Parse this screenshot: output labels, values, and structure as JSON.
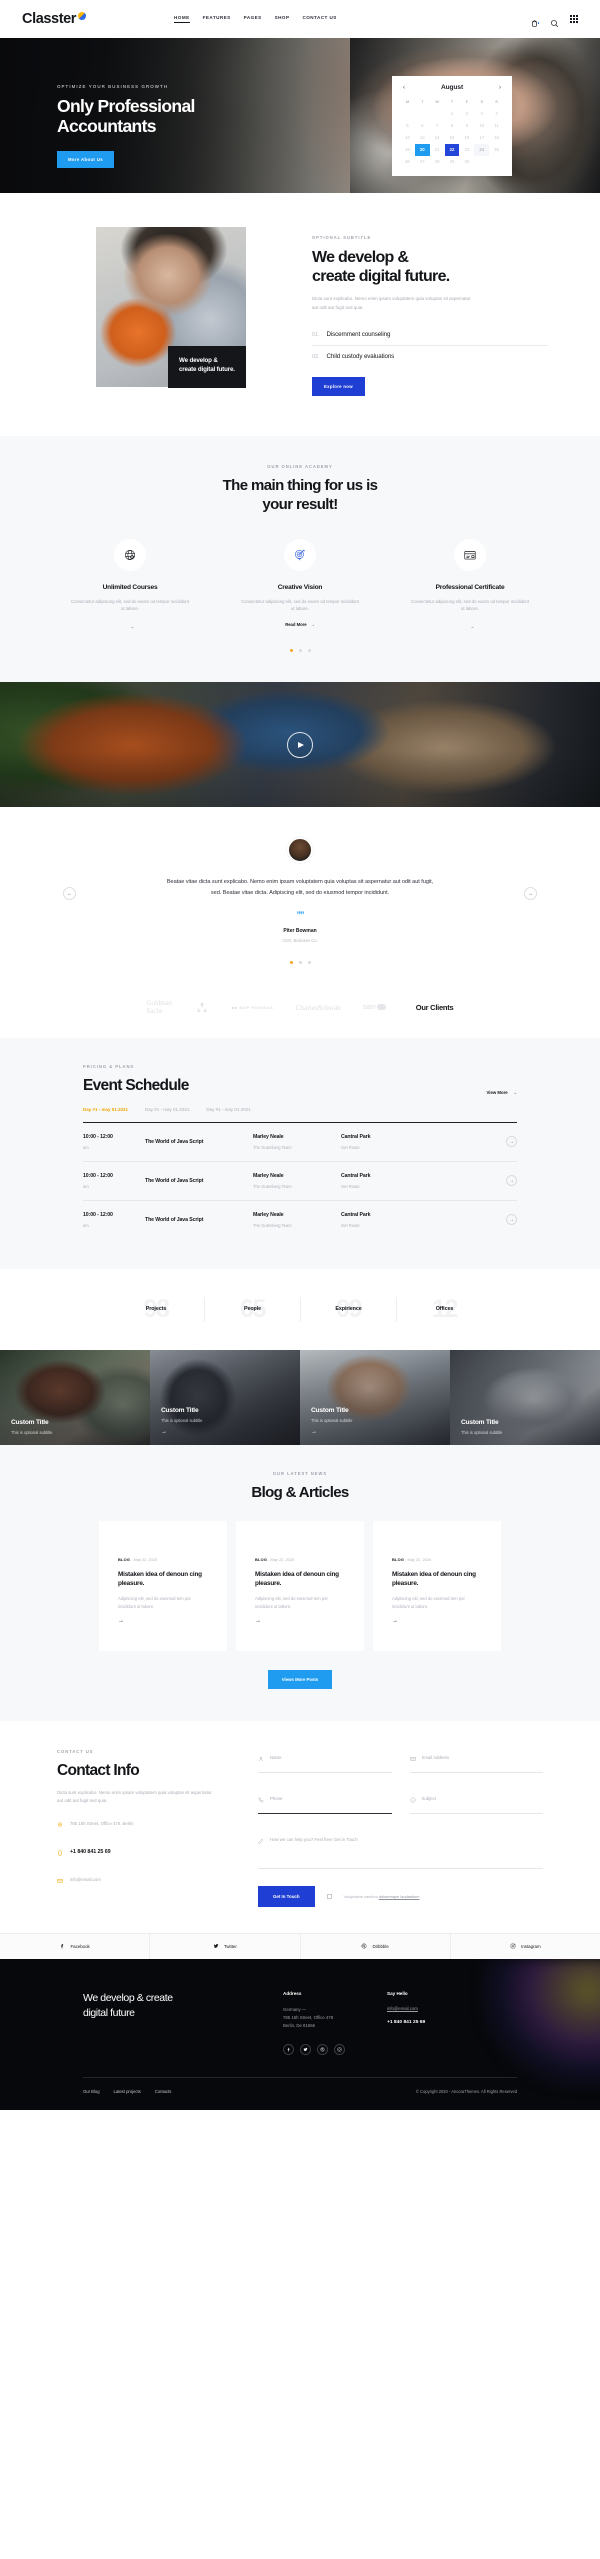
{
  "header": {
    "brand": "Classter",
    "nav": [
      {
        "label": "HOME",
        "active": true
      },
      {
        "label": "FEATURES",
        "active": false
      },
      {
        "label": "PAGES",
        "active": false
      },
      {
        "label": "SHOP",
        "active": false
      },
      {
        "label": "CONTACT US",
        "active": false
      }
    ],
    "tools": [
      "cart-icon",
      "search-icon",
      "grid-menu-icon"
    ]
  },
  "hero": {
    "kicker": "OPTIMIZE YOUR BUSINESS GROWTH",
    "title_line1": "Only Professional",
    "title_line2": "Accountants",
    "cta": "More About Us",
    "calendar": {
      "month": "August",
      "prev": "‹",
      "next": "›",
      "dow": [
        "M",
        "T",
        "W",
        "T",
        "F",
        "S",
        "S"
      ],
      "blanks": 3,
      "days": [
        1,
        2,
        3,
        4,
        5,
        6,
        7,
        8,
        9,
        10,
        11,
        12,
        13,
        14,
        15,
        16,
        17,
        18,
        19,
        20,
        21,
        22,
        23,
        24,
        25,
        26,
        27,
        28,
        29,
        30
      ],
      "highlight_light_blue": 20,
      "highlight_dark_blue": 22,
      "highlight_grey": 24
    }
  },
  "about": {
    "card_text": "We develop & create digital future.",
    "kicker": "OPTIONAL SUBTITLE",
    "title_line1": "We develop &",
    "title_line2": "create digital future.",
    "body": "Dicta sunt explicabo. Nemo enim ipsam voluptatem quia voluptas sit aspernatur aut odit aut fugit sed quia.",
    "list": [
      {
        "index": "01.",
        "text": "Discernment counseling"
      },
      {
        "index": "02.",
        "text": "Child custody evaluations"
      }
    ],
    "cta": "Explore now"
  },
  "features": {
    "kicker": "OUR ONLINE ACADEMY",
    "title_line1": "The main thing for us is",
    "title_line2": "your result!",
    "items": [
      {
        "icon": "globe-icon",
        "name": "Unlimited Courses",
        "body": "Consectetur adipiscing elit, sed do eiusm od tempor incididunt ut labore.",
        "more": ""
      },
      {
        "icon": "target-icon",
        "name": "Creative Vision",
        "body": "Consectetur adipiscing elit, sed do eiusm od tempor incididunt ut labore.",
        "more": "Read More"
      },
      {
        "icon": "card-icon",
        "name": "Professional Certificate",
        "body": "Consectetur adipiscing elit, sed do eiusm od tempor incididunt ut labore.",
        "more": ""
      }
    ],
    "dots": 3,
    "active_dot": 0
  },
  "video": {
    "play": "play-icon"
  },
  "testimonial": {
    "quote": "Beatae vitae dicta sunt explicabo. Nemo enim ipsam voluptatem quia voluptas sit aspernatur aut odit aut fugit, sed. Beatae vitae dicta. Adipiscing elit, sed do eiusmod tempor incididunt.",
    "mark": "””",
    "name": "Piter Bowman",
    "role": "CEO, Business Co.",
    "prev": "←",
    "next": "→",
    "dots": 3,
    "active_dot": 0
  },
  "clients": {
    "logos": [
      "Goldman Sachs",
      "recycle-icon",
      "BNP PARIBAS",
      "CharlesSchwab",
      "sam"
    ],
    "label": "Our Clients"
  },
  "events": {
    "kicker": "PRICING & PLANS",
    "title": "Event Schedule",
    "view_more": "View More",
    "tabs": [
      {
        "label": "Day #1 - may 01.2021",
        "active": true
      },
      {
        "label": "Day #1 - may 01.2021",
        "active": false
      },
      {
        "label": "Day #1 - may 01.2021",
        "active": false
      }
    ],
    "rows": [
      {
        "time": "10:00 - 12:00",
        "time_sub": "am",
        "topic": "The World of Java Script",
        "topic_sub": "",
        "person": "Marley Neale",
        "person_sub": "The Gutenberg Team",
        "place": "Cantral Park",
        "place_sub": "Get Route"
      },
      {
        "time": "10:00 - 12:00",
        "time_sub": "am",
        "topic": "The World of Java Script",
        "topic_sub": "",
        "person": "Marley Neale",
        "person_sub": "The Gutenberg Team",
        "place": "Cantral Park",
        "place_sub": "Get Route"
      },
      {
        "time": "10:00 - 12:00",
        "time_sub": "am",
        "topic": "The World of Java Script",
        "topic_sub": "",
        "person": "Marley Neale",
        "person_sub": "The Gutenberg Team",
        "place": "Cantral Park",
        "place_sub": "Get Route"
      }
    ]
  },
  "stats": [
    {
      "number": "98",
      "label": "Projects"
    },
    {
      "number": "65",
      "label": "People"
    },
    {
      "number": "09",
      "label": "Expirience"
    },
    {
      "number": "12",
      "label": "Offices"
    }
  ],
  "portfolio": [
    {
      "title": "Custom Title",
      "subtitle": "This is optional subtitle",
      "arrow": "→"
    },
    {
      "title": "Custom Title",
      "subtitle": "This is optional subtitle",
      "arrow": "→"
    },
    {
      "title": "Custom Title",
      "subtitle": "This is optional subtitle",
      "arrow": "→"
    },
    {
      "title": "Custom Title",
      "subtitle": "This is optional subtitle",
      "arrow": "→"
    }
  ],
  "blog": {
    "kicker": "OUR LATEST NEWS",
    "title": "Blog & Articles",
    "posts": [
      {
        "tag": "BLOG",
        "date": "May 22, 2020",
        "title": "Mistaken idea of denoun cing pleasure.",
        "body": "Adipiscing elit, sed do eiusmod tem por incididunt ut labore.",
        "arrow": "→"
      },
      {
        "tag": "BLOG",
        "date": "May 22, 2020",
        "title": "Mistaken idea of denoun cing pleasure.",
        "body": "Adipiscing elit, sed do eiusmod tem por incididunt ut labore.",
        "arrow": "→"
      },
      {
        "tag": "BLOG",
        "date": "May 22, 2020",
        "title": "Mistaken idea of denoun cing pleasure.",
        "body": "Adipiscing elit, sed do eiusmod tem por incididunt ut labore.",
        "arrow": "→"
      }
    ],
    "cta": "Views More Posts"
  },
  "contact": {
    "kicker": "CONTACT US",
    "title": "Contact Info",
    "body": "Dicta sunt explicabo. Nemo enim ipsam voluptatem quia voluptas sit aspernatur aut odit aut fugit sed quia.",
    "address": "785 15h Street, Office 478. Berlin",
    "phone": "+1 840 841 25 69",
    "email": "info@email.com",
    "form": {
      "name_placeholder": "Name",
      "email_placeholder": "Email Address",
      "phone_placeholder": "Phone",
      "subject_placeholder": "Subject",
      "message_placeholder": "How we can help you? Feel free! Get in Touch",
      "submit": "Get In Touch",
      "consent_text": "Voluptatem santium",
      "consent_link": "doloremque laudantium"
    }
  },
  "social_bar": [
    {
      "icon": "facebook-icon",
      "label": "Facebook"
    },
    {
      "icon": "twitter-icon",
      "label": "Twitter"
    },
    {
      "icon": "dribbble-icon",
      "label": "Dribbble"
    },
    {
      "icon": "instagram-icon",
      "label": "Instagram"
    }
  ],
  "footer": {
    "brand_line1": "We develop & create",
    "brand_line2": "digital future",
    "address_heading": "Address",
    "address_line1": "Germany —",
    "address_line2": "785 15h Street, Office 478",
    "address_line3": "Berlin, De 81566",
    "hello_heading": "Say Hello",
    "email": "info@email.com",
    "phone": "+1 840 841 25 69",
    "socials": [
      "facebook-icon",
      "twitter-icon",
      "dribbble-icon",
      "instagram-icon"
    ],
    "links": [
      "Our Blog",
      "Latest projects",
      "Contacts"
    ],
    "copyright": "© Copyright 2020 - AncoraThemes. All Rights Reserved"
  }
}
